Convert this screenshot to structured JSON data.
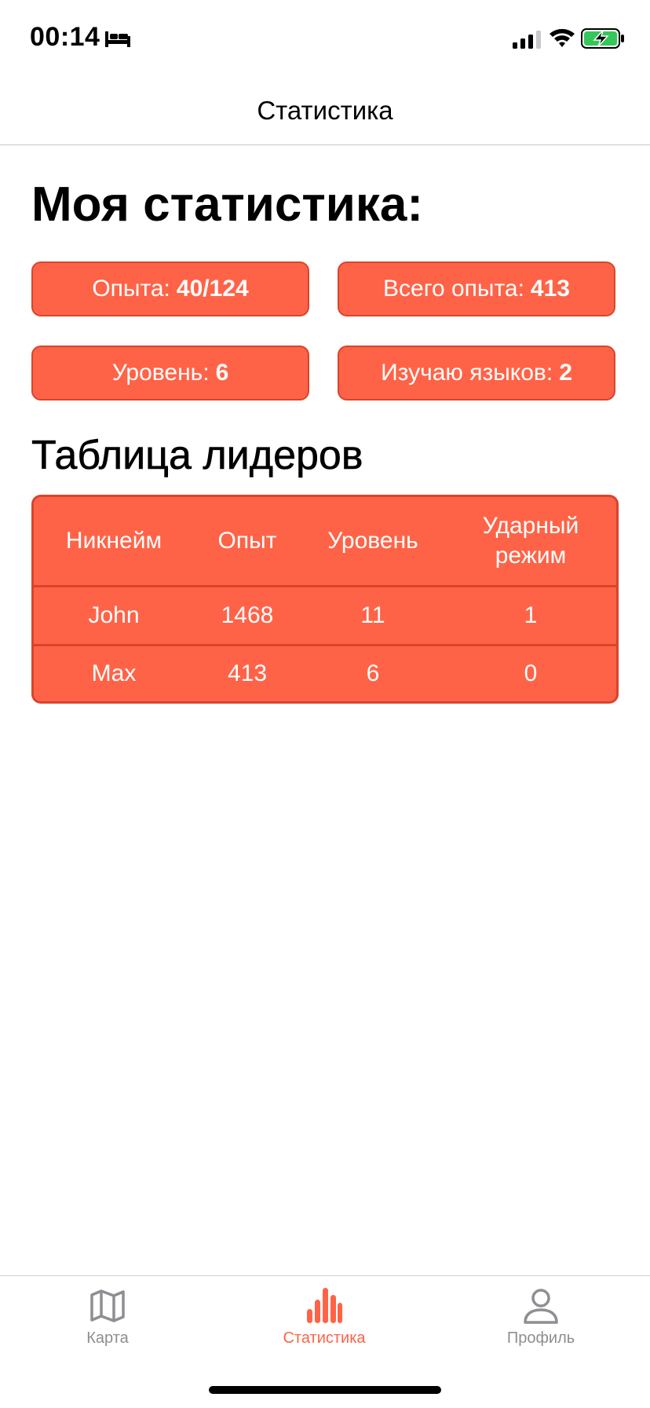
{
  "status_bar": {
    "time": "00:14",
    "icons": [
      "bed-icon",
      "signal-icon",
      "wifi-icon",
      "battery-charging-icon"
    ]
  },
  "nav": {
    "title": "Статистика"
  },
  "my_stats": {
    "title": "Моя статистика:",
    "cards": [
      {
        "label": "Опыта:",
        "value": "40/124"
      },
      {
        "label": "Всего опыта:",
        "value": "413"
      },
      {
        "label": "Уровень:",
        "value": "6"
      },
      {
        "label": "Изучаю языков:",
        "value": "2"
      }
    ]
  },
  "leaderboard": {
    "title": "Таблица лидеров",
    "columns": [
      "Никнейм",
      "Опыт",
      "Уровень",
      "Ударный режим"
    ],
    "rows": [
      [
        "John",
        "1468",
        "11",
        "1"
      ],
      [
        "Max",
        "413",
        "6",
        "0"
      ]
    ]
  },
  "tab_bar": {
    "items": [
      {
        "label": "Карта",
        "icon": "map-icon",
        "active": false
      },
      {
        "label": "Статистика",
        "icon": "bar-chart-icon",
        "active": true
      },
      {
        "label": "Профиль",
        "icon": "person-icon",
        "active": false
      }
    ]
  },
  "colors": {
    "accent": "#ff6347",
    "card_border": "#d8442c",
    "inactive_tab": "#8e8e93",
    "battery_green": "#34c759"
  }
}
